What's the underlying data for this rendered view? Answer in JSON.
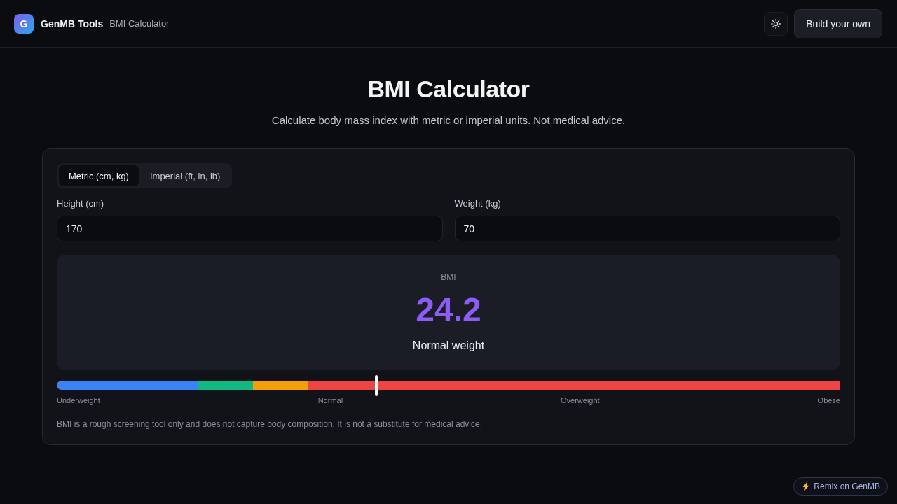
{
  "header": {
    "logo_letter": "G",
    "brand": "GenMB Tools",
    "page_name": "BMI Calculator",
    "build_button": "Build your own"
  },
  "title": "BMI Calculator",
  "subtitle": "Calculate body mass index with metric or imperial units. Not medical advice.",
  "unit_tabs": [
    {
      "label": "Metric (cm, kg)",
      "selected": true
    },
    {
      "label": "Imperial (ft, in, lb)",
      "selected": false
    }
  ],
  "fields": [
    {
      "label": "Height (cm)",
      "value": "170"
    },
    {
      "label": "Weight (kg)",
      "value": "70"
    }
  ],
  "result": {
    "label": "BMI",
    "value": "24.2",
    "category": "Normal weight"
  },
  "scale": {
    "segments": [
      {
        "color": "#3b82f6"
      },
      {
        "color": "#10b981"
      },
      {
        "color": "#f59e0b"
      },
      {
        "color": "#ef4444"
      }
    ],
    "marker": {
      "level": 0.408
    },
    "labels": [
      "Underweight",
      "Normal",
      "Overweight",
      "Obese"
    ]
  },
  "disclaimer": "BMI is a rough screening tool only and does not capture body composition. It is not a substitute for medical advice.",
  "remix_badge": "Remix on GenMB"
}
